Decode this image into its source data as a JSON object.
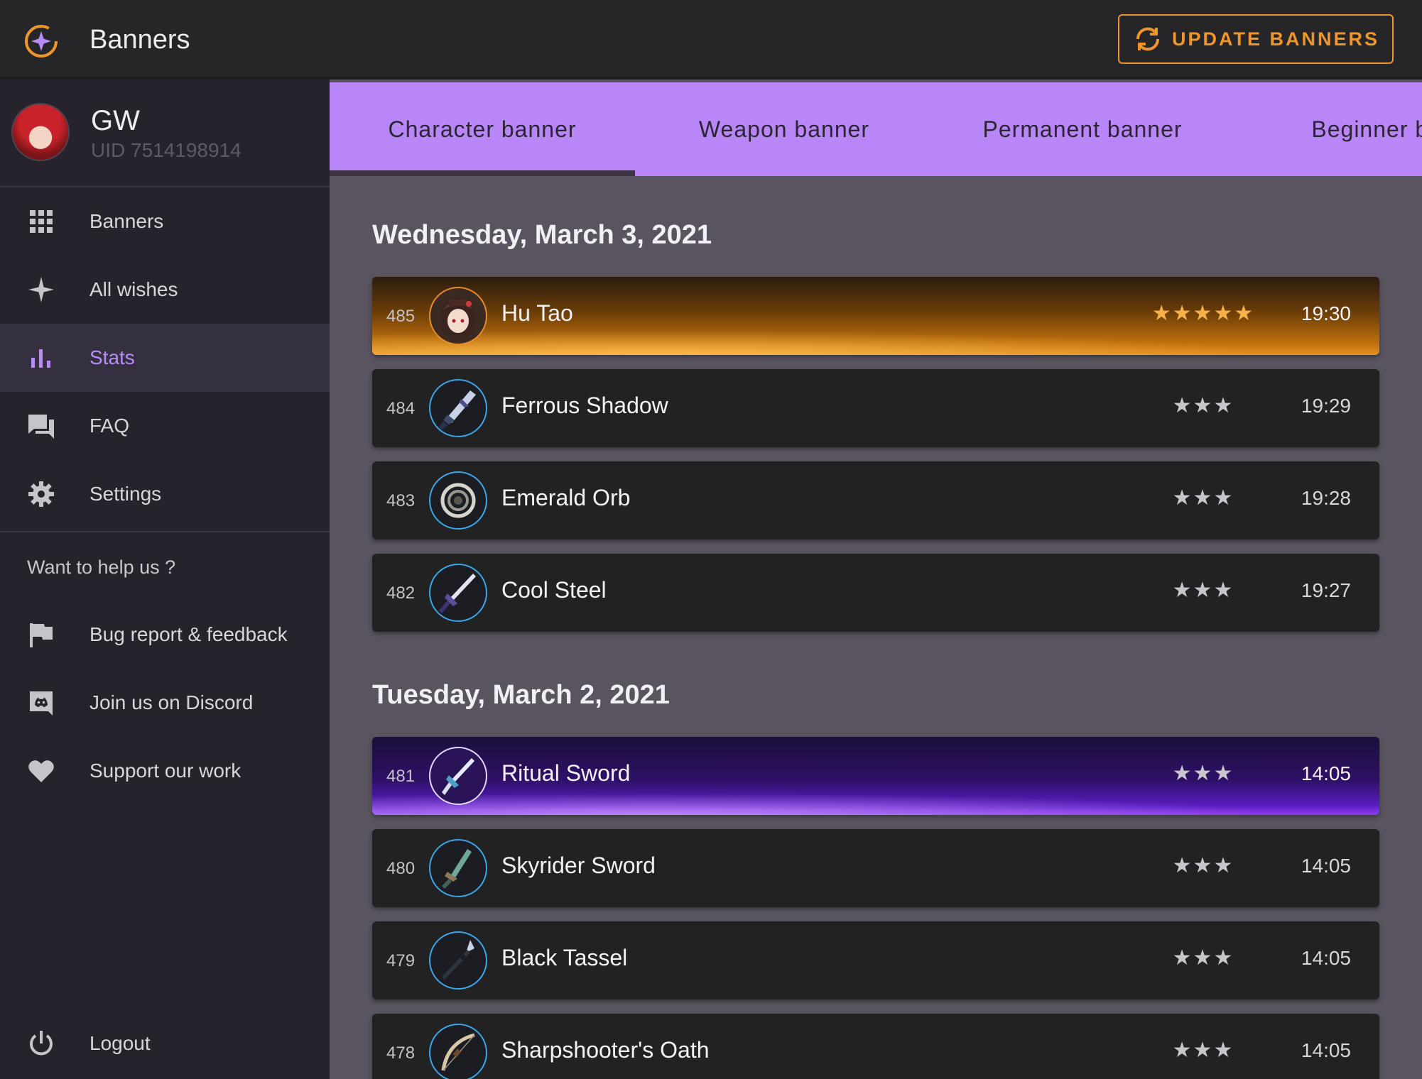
{
  "app": {
    "title": "Banners",
    "update_label": "UPDATE BANNERS",
    "accent": "#f0952a"
  },
  "profile": {
    "name": "GW",
    "uid": "UID 7514198914"
  },
  "nav": {
    "items": [
      {
        "label": "Banners",
        "icon": "grid-icon"
      },
      {
        "label": "All wishes",
        "icon": "sparkle-icon"
      },
      {
        "label": "Stats",
        "icon": "bar-chart-icon",
        "active": true
      },
      {
        "label": "FAQ",
        "icon": "chat-icon"
      },
      {
        "label": "Settings",
        "icon": "gear-icon"
      }
    ],
    "help_title": "Want to help us ?",
    "help_items": [
      {
        "label": "Bug report & feedback",
        "icon": "flag-icon"
      },
      {
        "label": "Join us on Discord",
        "icon": "discord-icon"
      },
      {
        "label": "Support our work",
        "icon": "heart-icon"
      }
    ],
    "logout": "Logout"
  },
  "tabs": [
    {
      "label": "Character banner",
      "active": true
    },
    {
      "label": "Weapon banner"
    },
    {
      "label": "Permanent banner"
    },
    {
      "label": "Beginner bar"
    }
  ],
  "days": [
    {
      "date": "Wednesday, March 3, 2021",
      "wishes": [
        {
          "num": "485",
          "name": "Hu Tao",
          "stars": "★★★★★",
          "time": "19:30",
          "rarity": "gold"
        },
        {
          "num": "484",
          "name": "Ferrous Shadow",
          "stars": "★★★",
          "time": "19:29",
          "rarity": "normal"
        },
        {
          "num": "483",
          "name": "Emerald Orb",
          "stars": "★★★",
          "time": "19:28",
          "rarity": "normal"
        },
        {
          "num": "482",
          "name": "Cool Steel",
          "stars": "★★★",
          "time": "19:27",
          "rarity": "normal"
        }
      ]
    },
    {
      "date": "Tuesday, March 2, 2021",
      "wishes": [
        {
          "num": "481",
          "name": "Ritual Sword",
          "stars": "★★★",
          "time": "14:05",
          "rarity": "purple"
        },
        {
          "num": "480",
          "name": "Skyrider Sword",
          "stars": "★★★",
          "time": "14:05",
          "rarity": "normal"
        },
        {
          "num": "479",
          "name": "Black Tassel",
          "stars": "★★★",
          "time": "14:05",
          "rarity": "normal"
        },
        {
          "num": "478",
          "name": "Sharpshooter's Oath",
          "stars": "★★★",
          "time": "14:05",
          "rarity": "normal"
        }
      ]
    }
  ]
}
